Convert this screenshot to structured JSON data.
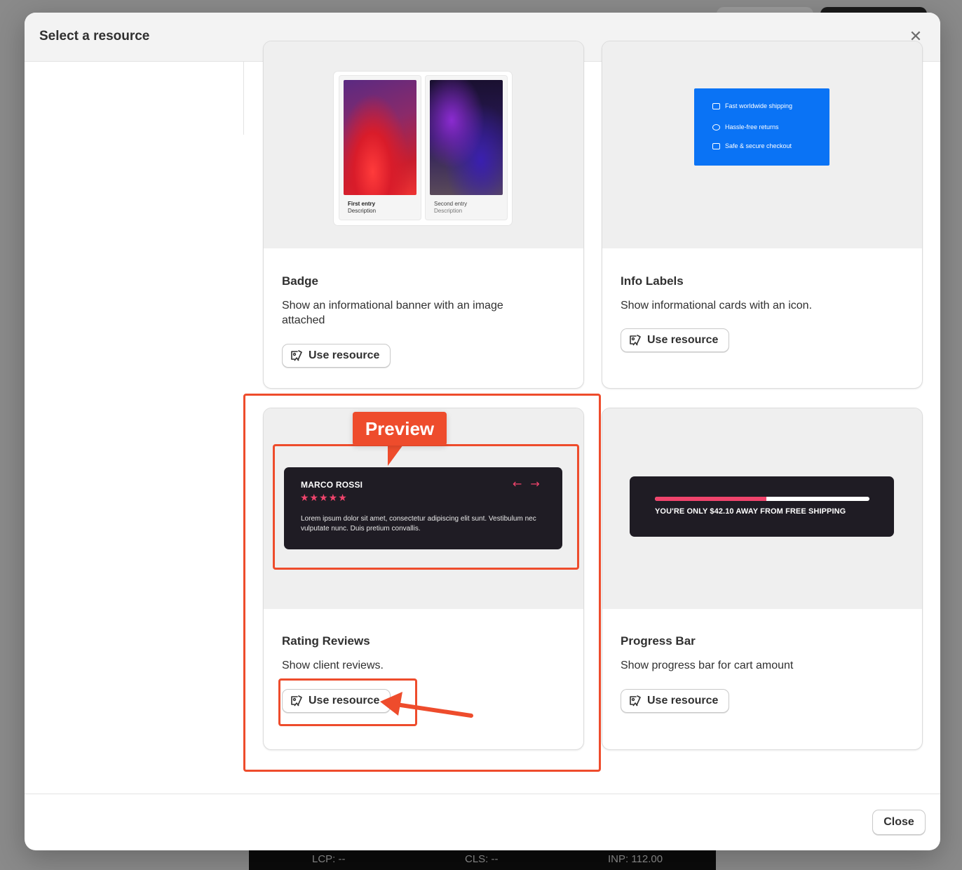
{
  "modal": {
    "title": "Select a resource",
    "close_icon": "close-icon",
    "footer_close_label": "Close"
  },
  "cards": [
    {
      "title": "Badge",
      "description": "Show an informational banner with an image attached",
      "button_label": "Use resource",
      "preview": {
        "entries": [
          {
            "title": "First entry",
            "description": "Description"
          },
          {
            "title": "Second entry",
            "description": "Description"
          }
        ]
      }
    },
    {
      "title": "Info Labels",
      "description": "Show informational cards with an icon.",
      "button_label": "Use resource",
      "preview": {
        "items": [
          {
            "icon": "truck-icon",
            "text": "Fast worldwide shipping"
          },
          {
            "icon": "refresh-icon",
            "text": "Hassle-free returns"
          },
          {
            "icon": "card-icon",
            "text": "Safe & secure checkout"
          }
        ],
        "accent_color": "#0a73f5"
      }
    },
    {
      "title": "Rating Reviews",
      "description": "Show client reviews.",
      "button_label": "Use resource",
      "preview": {
        "name": "MARCO ROSSI",
        "stars": "★★★★★",
        "rating": 5,
        "arrows": "←→",
        "text": "Lorem ipsum dolor sit amet, consectetur adipiscing elit sunt. Vestibulum nec vulputate nunc. Duis pretium convallis.",
        "accent_color": "#f0446c"
      }
    },
    {
      "title": "Progress Bar",
      "description": "Show progress bar for cart amount",
      "button_label": "Use resource",
      "preview": {
        "message": "YOU'RE ONLY $42.10 AWAY FROM FREE SHIPPING",
        "progress_percent": 52,
        "accent_color": "#f0446c"
      }
    }
  ],
  "annotation": {
    "callout_label": "Preview",
    "color": "#ee4c2c"
  },
  "perf_bar": {
    "lcp": "LCP: --",
    "cls": "CLS: --",
    "inp": "INP: 112.00"
  }
}
